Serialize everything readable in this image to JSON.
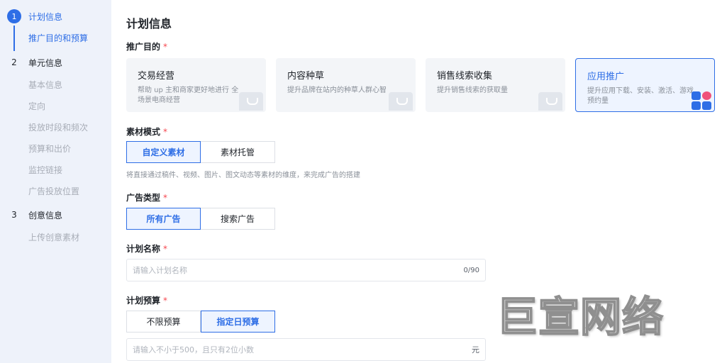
{
  "sidebar": {
    "steps": [
      {
        "num": "1",
        "title": "计划信息",
        "subs": [
          "推广目的和预算"
        ]
      },
      {
        "num": "2",
        "title": "单元信息",
        "subs": [
          "基本信息",
          "定向",
          "投放时段和频次",
          "预算和出价",
          "监控链接",
          "广告投放位置"
        ]
      },
      {
        "num": "3",
        "title": "创意信息",
        "subs": [
          "上传创意素材"
        ]
      }
    ]
  },
  "main": {
    "title": "计划信息",
    "purpose": {
      "label": "推广目的",
      "cards": [
        {
          "title": "交易经营",
          "desc": "帮助 up 主和商家更好地进行  全场景电商经营"
        },
        {
          "title": "内容种草",
          "desc": "提升品牌在站内的种草人群心智"
        },
        {
          "title": "销售线索收集",
          "desc": "提升销售线索的获取量"
        },
        {
          "title": "应用推广",
          "desc": "提升应用下载、安装、激活、游戏预约量"
        }
      ]
    },
    "material": {
      "label": "素材模式",
      "options": [
        "自定义素材",
        "素材托管"
      ],
      "hint": "将直接通过稿件、视频、图片、图文动态等素材的维度，来完成广告的搭建"
    },
    "ad_type": {
      "label": "广告类型",
      "options": [
        "所有广告",
        "搜索广告"
      ]
    },
    "plan_name": {
      "label": "计划名称",
      "placeholder": "请输入计划名称",
      "counter": "0/90"
    },
    "budget": {
      "label": "计划预算",
      "options": [
        "不限预算",
        "指定日预算"
      ],
      "placeholder": "请输入不小于500，且只有2位小数",
      "unit": "元"
    }
  },
  "watermark": "巨宣网络",
  "colors": {
    "accent": "#2e6ee6",
    "required": "#f5474f",
    "sidebar_bg": "#eef2fa"
  }
}
